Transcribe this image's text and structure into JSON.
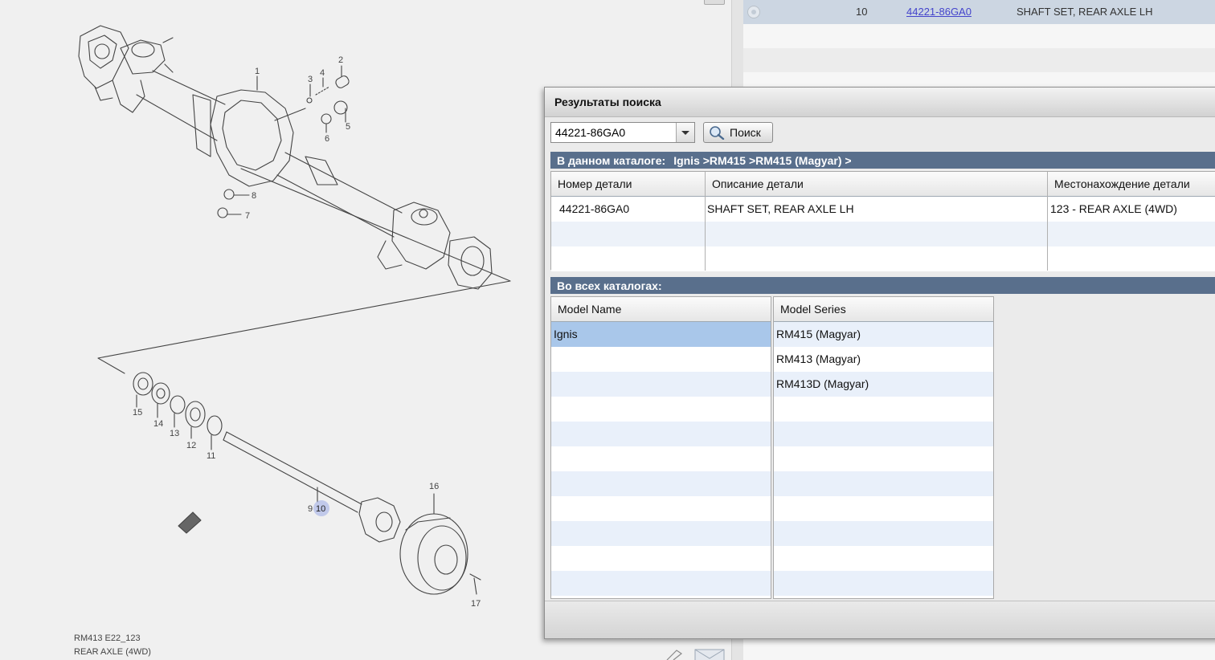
{
  "diagram": {
    "labels": {
      "code": "RM413 E22_123",
      "title": "REAR AXLE (4WD)"
    },
    "callouts": [
      "1",
      "2",
      "3",
      "4",
      "5",
      "6",
      "7",
      "8",
      "9",
      "10",
      "11",
      "12",
      "13",
      "14",
      "15",
      "16",
      "17"
    ],
    "highlighted_callout": "10"
  },
  "parts_list": {
    "selected_row": {
      "number": "10",
      "part_no": "44221-86GA0",
      "description": "SHAFT SET, REAR AXLE LH"
    }
  },
  "dialog": {
    "title": "Результаты поиска",
    "search": {
      "value": "44221-86GA0",
      "button_label": "Поиск"
    },
    "catalog_section": {
      "label": "В данном каталоге:",
      "path": "Ignis >RM415 >RM415 (Magyar) >"
    },
    "catalog_table": {
      "headers": [
        "Номер детали",
        "Описание детали",
        "Местонахождение детали"
      ],
      "rows": [
        [
          "44221-86GA0",
          "SHAFT SET, REAR AXLE LH",
          "123 - REAR AXLE (4WD)"
        ]
      ]
    },
    "all_catalogs_section": {
      "label": "Во всех каталогах:"
    },
    "model_names": {
      "header": "Model Name",
      "items": [
        "Ignis"
      ]
    },
    "model_series": {
      "header": "Model Series",
      "items": [
        "RM415 (Magyar)",
        "RM413 (Magyar)",
        "RM413D (Magyar)"
      ]
    }
  },
  "colors": {
    "section_header": "#596f8c",
    "selection": "#a9c7ea",
    "link": "#4444cc",
    "highlight_callout": "#9aa9e6"
  }
}
